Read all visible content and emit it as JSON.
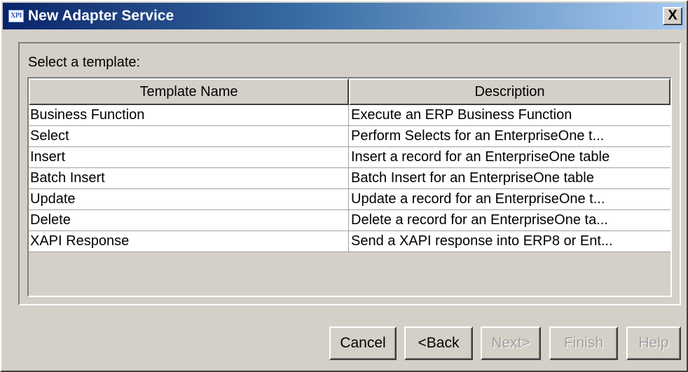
{
  "window": {
    "icon_text": "XPI",
    "title": "New Adapter Service",
    "close_label": "X"
  },
  "panel": {
    "label": "Select a template:"
  },
  "table": {
    "columns": [
      "Template Name",
      "Description"
    ],
    "rows": [
      {
        "name": "Business Function",
        "description": "Execute an ERP Business Function"
      },
      {
        "name": "Select",
        "description": "Perform Selects for an EnterpriseOne t..."
      },
      {
        "name": "Insert",
        "description": "Insert a record for an EnterpriseOne table"
      },
      {
        "name": "Batch Insert",
        "description": "Batch Insert for an EnterpriseOne table"
      },
      {
        "name": "Update",
        "description": "Update a record for an EnterpriseOne t..."
      },
      {
        "name": "Delete",
        "description": "Delete a record for an EnterpriseOne ta..."
      },
      {
        "name": "XAPI Response",
        "description": "Send a XAPI response into ERP8 or Ent..."
      }
    ]
  },
  "buttons": {
    "cancel": "Cancel",
    "back": "<Back",
    "next": "Next>",
    "finish": "Finish",
    "help": "Help"
  },
  "colors": {
    "titlebar_start": "#0a246a",
    "titlebar_end": "#a6caf0",
    "face": "#d4d0c8"
  }
}
